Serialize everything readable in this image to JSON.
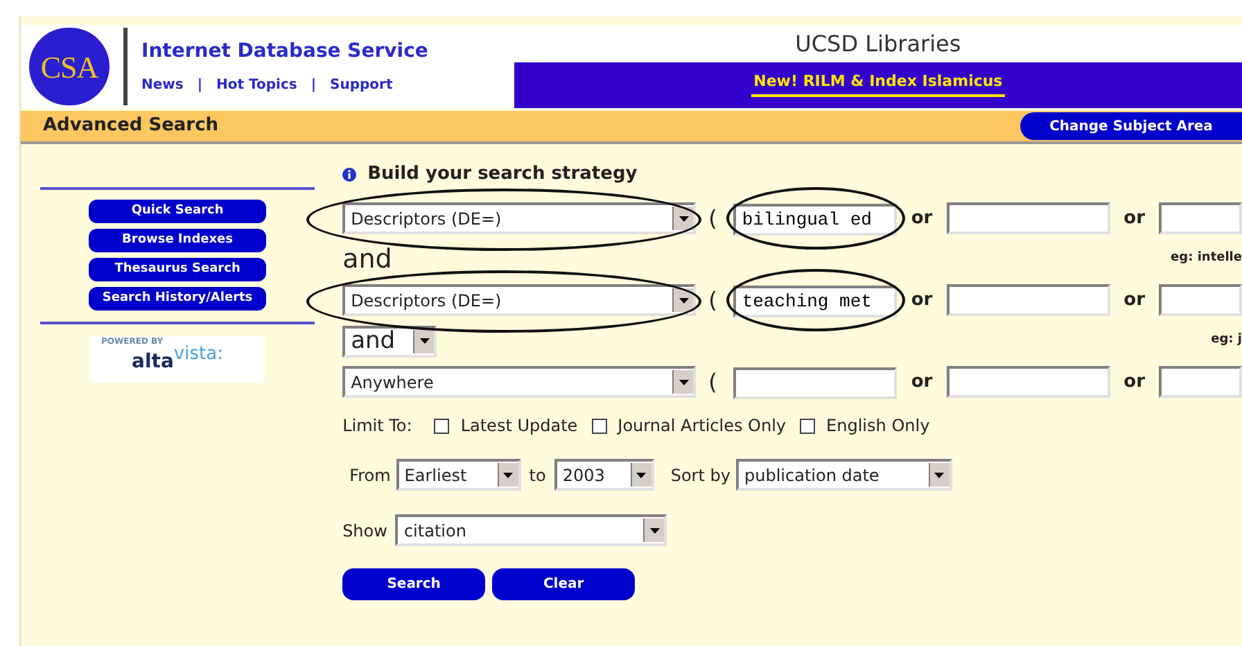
{
  "header": {
    "logo": "CSA",
    "title": "Internet Database Service",
    "links": [
      "News",
      "Hot Topics",
      "Support"
    ],
    "separators": [
      "|",
      "|"
    ],
    "library": "UCSD Libraries",
    "banner": "New! RILM & Index Islamicus"
  },
  "page_bar": {
    "title": "Advanced Search",
    "button": "Change Subject Area"
  },
  "sidebar": {
    "buttons": [
      "Quick Search",
      "Browse Indexes",
      "Thesaurus Search",
      "Search History/Alerts"
    ],
    "powered_by": "POWERED BY",
    "brand": "alta",
    "brand_raised": "vista:"
  },
  "search": {
    "heading": "Build your search strategy",
    "rows": [
      {
        "field": "Descriptors (DE=)",
        "circled": true,
        "paren": "(",
        "joins": [
          "or",
          "or"
        ],
        "terms": [
          {
            "kind": "text",
            "value": "bilingual ed"
          },
          {
            "kind": "blank"
          },
          {
            "kind": "blank"
          }
        ]
      },
      {
        "connector": {
          "kind": "text",
          "value": "and",
          "hint": "eg: intelle"
        },
        "field": "Descriptors (DE=)",
        "circled": true,
        "paren": "(",
        "joins": [
          "or",
          "or"
        ],
        "terms": [
          {
            "kind": "text",
            "value": "teaching met"
          },
          {
            "kind": "blank"
          },
          {
            "kind": "blank"
          }
        ]
      },
      {
        "connector": {
          "kind": "select",
          "value": "and",
          "hint": "eg: j"
        },
        "field": "Anywhere",
        "circled": false,
        "paren": "(",
        "joins": [
          "or",
          "or"
        ],
        "terms": [
          {
            "kind": "blank"
          },
          {
            "kind": "blank"
          },
          {
            "kind": "blank"
          }
        ]
      }
    ]
  },
  "limit": {
    "label": "Limit To:",
    "options": [
      {
        "label": "Latest Update",
        "checked": false
      },
      {
        "label": "Journal Articles Only",
        "checked": false
      },
      {
        "label": "English Only",
        "checked": false
      }
    ]
  },
  "dates": {
    "from_label": "From",
    "from": "Earliest",
    "to_label": "to",
    "to": "2003",
    "sort_label": "Sort by",
    "sort": "publication date"
  },
  "show": {
    "label": "Show",
    "value": "citation"
  },
  "buttons": [
    "Search",
    "Clear"
  ]
}
